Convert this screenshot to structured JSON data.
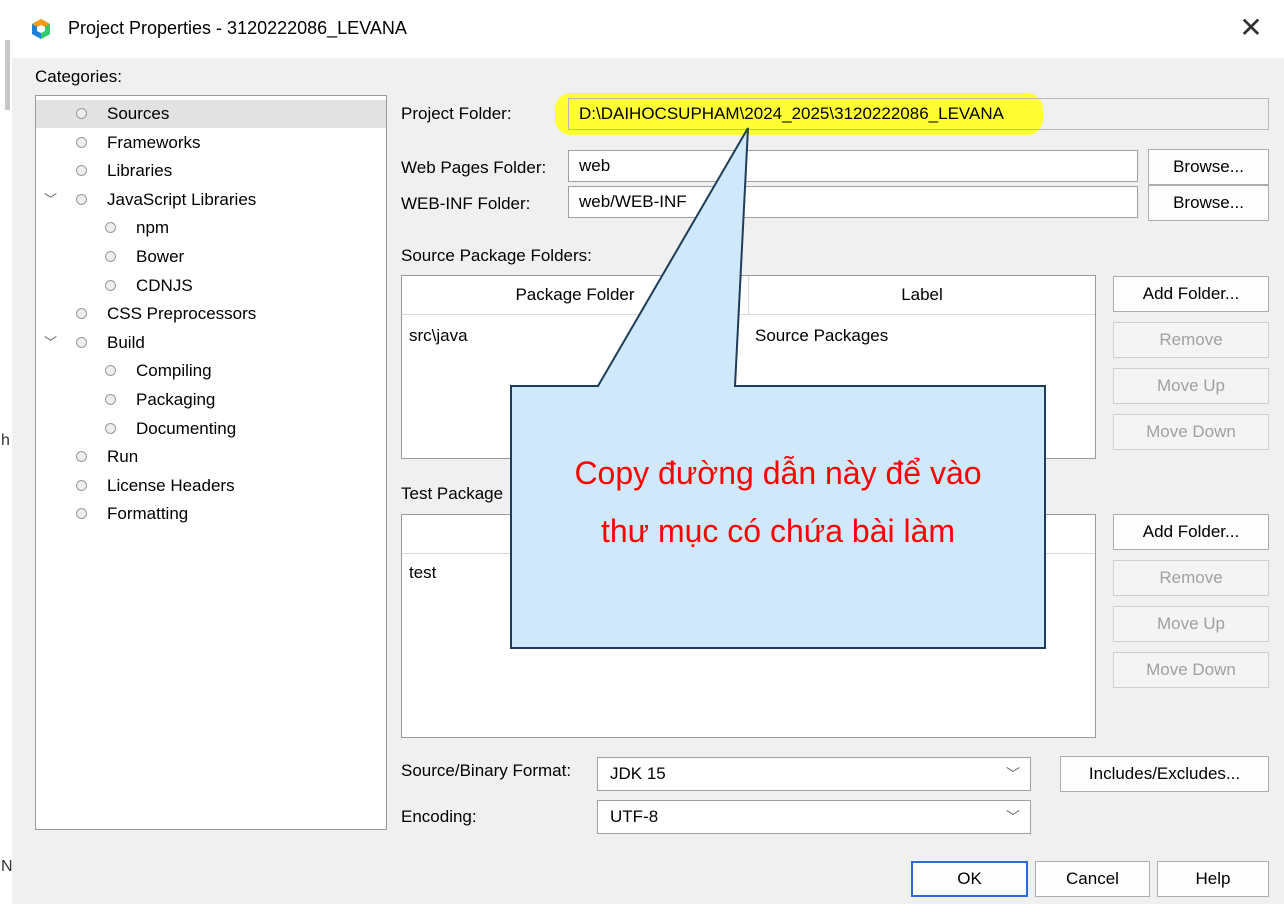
{
  "window": {
    "title": "Project Properties - 3120222086_LEVANA",
    "close_glyph": "✕",
    "behind_glyph_1": "h",
    "behind_glyph_2": "N"
  },
  "categories": {
    "label": "Categories:",
    "items": [
      {
        "label": "Sources",
        "level": 0,
        "selected": true
      },
      {
        "label": "Frameworks",
        "level": 0
      },
      {
        "label": "Libraries",
        "level": 0
      },
      {
        "label": "JavaScript Libraries",
        "level": 0,
        "expanded": true
      },
      {
        "label": "npm",
        "level": 1
      },
      {
        "label": "Bower",
        "level": 1
      },
      {
        "label": "CDNJS",
        "level": 1
      },
      {
        "label": "CSS Preprocessors",
        "level": 0
      },
      {
        "label": "Build",
        "level": 0,
        "expanded": true
      },
      {
        "label": "Compiling",
        "level": 1
      },
      {
        "label": "Packaging",
        "level": 1
      },
      {
        "label": "Documenting",
        "level": 1
      },
      {
        "label": "Run",
        "level": 0
      },
      {
        "label": "License Headers",
        "level": 0
      },
      {
        "label": "Formatting",
        "level": 0
      }
    ]
  },
  "form": {
    "project_folder_label": "Project Folder:",
    "project_folder_value": "D:\\DAIHOCSUPHAM\\2024_2025\\3120222086_LEVANA",
    "web_pages_label": "Web Pages Folder:",
    "web_pages_value": "web",
    "webinf_label": "WEB-INF Folder:",
    "webinf_value": "web/WEB-INF",
    "browse_label": "Browse...",
    "source_pkg_label": "Source Package Folders:",
    "source_table": {
      "col_folder": "Package Folder",
      "col_label": "Label",
      "rows": [
        {
          "folder": "src\\java",
          "label": "Source Packages"
        }
      ]
    },
    "test_pkg_label": "Test Package",
    "test_table": {
      "rows": [
        {
          "folder": "test"
        }
      ]
    },
    "add_folder": "Add Folder...",
    "remove": "Remove",
    "move_up": "Move Up",
    "move_down": "Move Down",
    "format_label": "Source/Binary Format:",
    "format_value": "JDK 15",
    "includes_excludes": "Includes/Excludes...",
    "encoding_label": "Encoding:",
    "encoding_value": "UTF-8"
  },
  "footer": {
    "ok": "OK",
    "cancel": "Cancel",
    "help": "Help"
  },
  "callout": {
    "line1": "Copy đường dẫn này để vào",
    "line2": "thư mục có chứa bài làm"
  },
  "colors": {
    "highlight": "#ffff33",
    "callout_fill": "#cfe8fa",
    "callout_text": "#ff0000",
    "accent_border": "#2b6cd4"
  }
}
